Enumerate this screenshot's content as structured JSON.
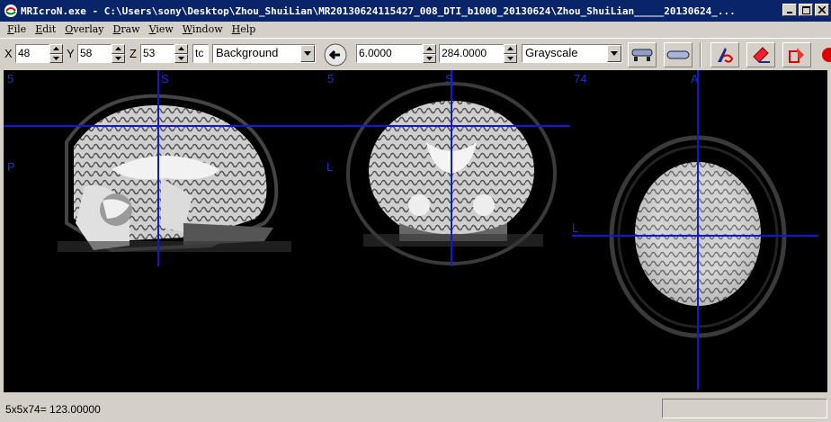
{
  "window": {
    "title": "MRIcroN.exe - C:\\Users\\sony\\Desktop\\Zhou_ShuiLian\\MR20130624115427_008_DTI_b1000_20130624\\Zhou_ShuiLian_____20130624_...",
    "icon": "mricron-app-icon"
  },
  "menu": [
    "File",
    "Edit",
    "Overlay",
    "Draw",
    "View",
    "Window",
    "Help"
  ],
  "toolbar": {
    "x_label": "X",
    "x_value": "48",
    "y_label": "Y",
    "y_value": "58",
    "z_label": "Z",
    "z_value": "53",
    "truncated_field": "tc",
    "layer": "Background",
    "min_intensity": "6.0000",
    "max_intensity": "284.0000",
    "colorscheme": "Grayscale",
    "icons": [
      "back-arrow-icon",
      "layout-icon",
      "oval-icon",
      "pen-draw-icon",
      "eraser-icon",
      "fill-icon",
      "more-icon"
    ]
  },
  "views": {
    "sagittal": {
      "top_left": "5",
      "top_center": "S",
      "left": "P"
    },
    "coronal": {
      "top_left": "5",
      "top_center": "S",
      "left": "L"
    },
    "axial": {
      "top_left": "74",
      "top_center": "A",
      "left": "L"
    }
  },
  "status": {
    "text": "5x5x74= 123.00000"
  },
  "colors": {
    "crosshair": "#1414e0",
    "label": "#1f2fd6",
    "title_bg": "#0a246a",
    "face": "#d4d0c8"
  }
}
